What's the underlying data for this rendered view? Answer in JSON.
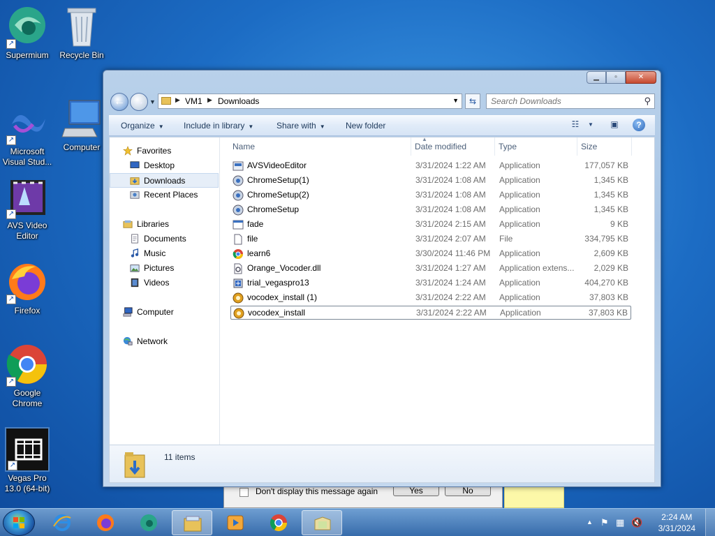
{
  "desktop": {
    "icons": [
      {
        "label": "Supermium",
        "icon": "supermium-icon"
      },
      {
        "label": "Recycle Bin",
        "icon": "recycle-bin-icon"
      },
      {
        "label": "Microsoft Visual Stud...",
        "icon": "visual-studio-icon"
      },
      {
        "label": "Computer",
        "icon": "computer-icon"
      },
      {
        "label": "AVS Video Editor",
        "icon": "avs-video-editor-icon"
      },
      {
        "label": "Firefox",
        "icon": "firefox-icon"
      },
      {
        "label": "Google Chrome",
        "icon": "chrome-icon"
      },
      {
        "label": "Vegas Pro 13.0 (64-bit)",
        "icon": "vegas-pro-icon"
      }
    ]
  },
  "background_dialog": {
    "checkbox_label": "Don't display this message again",
    "yes_label": "Yes",
    "no_label": "No"
  },
  "window": {
    "caption": {
      "minimize": "▁",
      "maximize": "▫",
      "close": "✕"
    },
    "address": {
      "crumbs": [
        "VM1",
        "Downloads"
      ]
    },
    "search": {
      "placeholder": "Search Downloads"
    },
    "toolbar": {
      "organize": "Organize",
      "include_in_library": "Include in library",
      "share_with": "Share with",
      "new_folder": "New folder"
    },
    "nav": {
      "favorites": "Favorites",
      "desktop": "Desktop",
      "downloads": "Downloads",
      "recent_places": "Recent Places",
      "libraries": "Libraries",
      "documents": "Documents",
      "music": "Music",
      "pictures": "Pictures",
      "videos": "Videos",
      "computer": "Computer",
      "network": "Network"
    },
    "columns": {
      "name": "Name",
      "date": "Date modified",
      "type": "Type",
      "size": "Size"
    },
    "files": [
      {
        "name": "AVSVideoEditor",
        "date": "3/31/2024 1:22 AM",
        "type": "Application",
        "size": "177,057 KB",
        "icon": "app-installer-icon"
      },
      {
        "name": "ChromeSetup(1)",
        "date": "3/31/2024 1:08 AM",
        "type": "Application",
        "size": "1,345 KB",
        "icon": "setup-icon"
      },
      {
        "name": "ChromeSetup(2)",
        "date": "3/31/2024 1:08 AM",
        "type": "Application",
        "size": "1,345 KB",
        "icon": "setup-icon"
      },
      {
        "name": "ChromeSetup",
        "date": "3/31/2024 1:08 AM",
        "type": "Application",
        "size": "1,345 KB",
        "icon": "setup-icon"
      },
      {
        "name": "fade",
        "date": "3/31/2024 2:15 AM",
        "type": "Application",
        "size": "9 KB",
        "icon": "exe-icon"
      },
      {
        "name": "file",
        "date": "3/31/2024 2:07 AM",
        "type": "File",
        "size": "334,795 KB",
        "icon": "blank-file-icon"
      },
      {
        "name": "learn6",
        "date": "3/30/2024 11:46 PM",
        "type": "Application",
        "size": "2,609 KB",
        "icon": "chrome-app-icon"
      },
      {
        "name": "Orange_Vocoder.dll",
        "date": "3/31/2024 1:27 AM",
        "type": "Application extens...",
        "size": "2,029 KB",
        "icon": "dll-icon"
      },
      {
        "name": "trial_vegaspro13",
        "date": "3/31/2024 1:24 AM",
        "type": "Application",
        "size": "404,270 KB",
        "icon": "installer-icon"
      },
      {
        "name": "vocodex_install (1)",
        "date": "3/31/2024 2:22 AM",
        "type": "Application",
        "size": "37,803 KB",
        "icon": "vocodex-icon"
      },
      {
        "name": "vocodex_install",
        "date": "3/31/2024 2:22 AM",
        "type": "Application",
        "size": "37,803 KB",
        "icon": "vocodex-icon"
      }
    ],
    "selected_file": "vocodex_install",
    "status": {
      "item_count": "11 items"
    }
  },
  "taskbar": {
    "apps": [
      "internet-explorer-icon",
      "firefox-icon",
      "supermium-icon",
      "file-explorer-icon",
      "media-player-icon",
      "chrome-icon",
      "folder-windows-icon"
    ],
    "clock_time": "2:24 AM",
    "clock_date": "3/31/2024"
  }
}
